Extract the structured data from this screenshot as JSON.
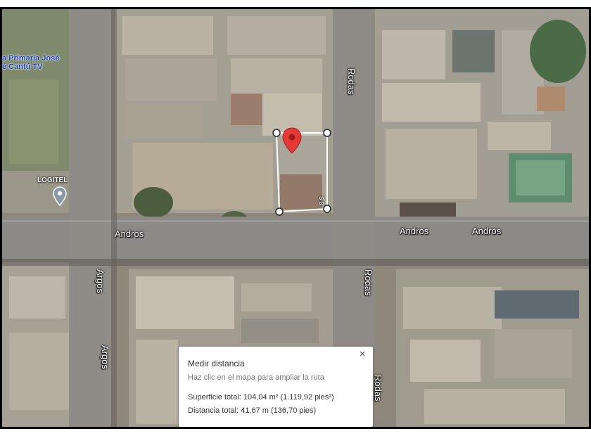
{
  "map": {
    "view": "satellite",
    "roads": {
      "rodas_top": "Rodas",
      "rodas_bottom": "Rodas",
      "rodas_panel": "Rodas",
      "andros_left": "Andros",
      "andros_mid": "Andros",
      "andros_right": "Andros",
      "argos_top": "Argos",
      "argos_bottom": "Argos"
    },
    "places": {
      "school_line1": "a Primaria José",
      "school_line2": "é Cantú TV",
      "logitel": "LOGITEL"
    },
    "edge_label": "S S",
    "colors": {
      "pin": "#e53935",
      "poi_text": "#1a3fbf"
    }
  },
  "measure_panel": {
    "title": "Medir distancia",
    "hint": "Haz clic en el mapa para ampliar la ruta",
    "area": "Superficie total: 104,04 m² (1.119,92 pies²)",
    "distance": "Distancia total: 41,67 m (136,70 pies)",
    "close_icon": "×"
  }
}
